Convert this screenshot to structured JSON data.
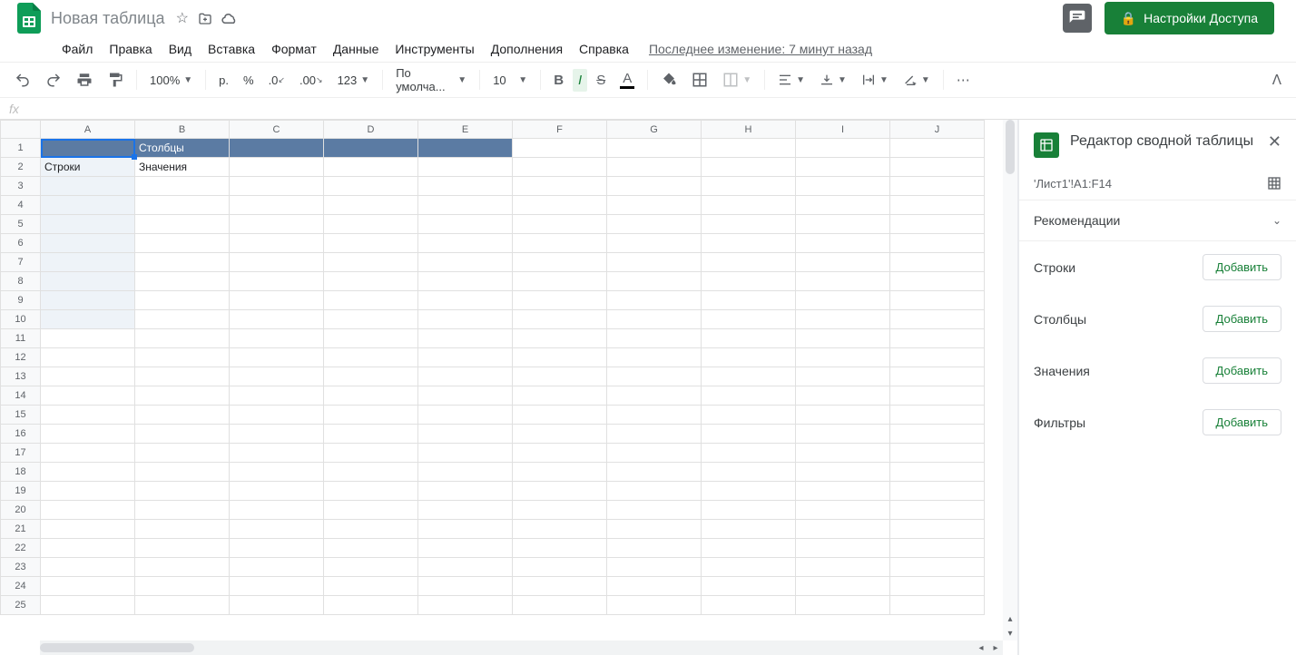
{
  "header": {
    "doc_title": "Новая таблица",
    "share_label": "Настройки Доступа"
  },
  "menu": {
    "items": [
      "Файл",
      "Правка",
      "Вид",
      "Вставка",
      "Формат",
      "Данные",
      "Инструменты",
      "Дополнения",
      "Справка"
    ],
    "last_change": "Последнее изменение: 7 минут назад"
  },
  "toolbar": {
    "zoom": "100%",
    "currency": "р.",
    "percent": "%",
    "dec_dec": ".0",
    "inc_dec": ".00",
    "num_format": "123",
    "font": "По умолча...",
    "font_size": "10"
  },
  "formula": {
    "fx": "fx",
    "value": ""
  },
  "grid": {
    "col_headers": [
      "A",
      "B",
      "C",
      "D",
      "E",
      "F",
      "G",
      "H",
      "I",
      "J"
    ],
    "row_count": 25,
    "cells": {
      "B1": "Столбцы",
      "A2": "Строки",
      "B2": "Значения"
    }
  },
  "panel": {
    "title": "Редактор сводной таблицы",
    "range": "'Лист1'!A1:F14",
    "recommendations": "Рекомендации",
    "sections": [
      {
        "label": "Строки",
        "button": "Добавить"
      },
      {
        "label": "Столбцы",
        "button": "Добавить"
      },
      {
        "label": "Значения",
        "button": "Добавить"
      },
      {
        "label": "Фильтры",
        "button": "Добавить"
      }
    ]
  }
}
